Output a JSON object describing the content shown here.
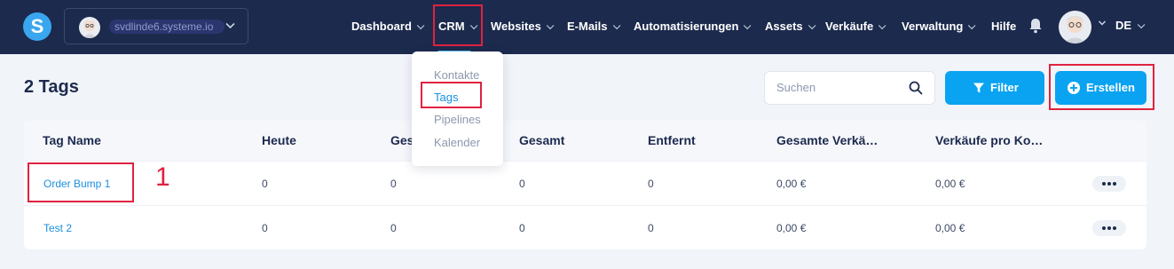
{
  "topbar": {
    "logo_letter": "S",
    "account_name": "svdlinde6.systeme.io",
    "nav": [
      {
        "label": "Dashboard"
      },
      {
        "label": "CRM"
      },
      {
        "label": "Websites"
      },
      {
        "label": "E-Mails"
      },
      {
        "label": "Automatisierungen"
      },
      {
        "label": "Assets"
      },
      {
        "label": "Verkäufe"
      },
      {
        "label": "Verwaltung"
      },
      {
        "label": "Hilfe"
      }
    ],
    "language": "DE"
  },
  "crm_dropdown": {
    "items": [
      {
        "label": "Kontakte",
        "active": false
      },
      {
        "label": "Tags",
        "active": true
      },
      {
        "label": "Pipelines",
        "active": false
      },
      {
        "label": "Kalender",
        "active": false
      }
    ]
  },
  "page": {
    "title": "2 Tags",
    "search_placeholder": "Suchen",
    "filter_label": "Filter",
    "create_label": "Erstellen"
  },
  "table": {
    "columns": [
      "Tag Name",
      "Heute",
      "Gestern",
      "Gesamt",
      "Entfernt",
      "Gesamte Verkä…",
      "Verkäufe pro Ko…"
    ],
    "rows": [
      {
        "name": "Order Bump 1",
        "heute": "0",
        "gestern": "0",
        "gesamt": "0",
        "entfernt": "0",
        "gesamte_verkaeufe": "0,00 €",
        "verkaeufe_pro_kontakt": "0,00 €"
      },
      {
        "name": "Test 2",
        "heute": "0",
        "gestern": "0",
        "gesamt": "0",
        "entfernt": "0",
        "gesamte_verkaeufe": "0,00 €",
        "verkaeufe_pro_kontakt": "0,00 €"
      }
    ]
  },
  "annotation": {
    "number": "1"
  },
  "colors": {
    "nav_bg": "#1c2a4d",
    "accent": "#0aa3f2",
    "highlight": "#e0223f",
    "link": "#1a8fe0"
  }
}
